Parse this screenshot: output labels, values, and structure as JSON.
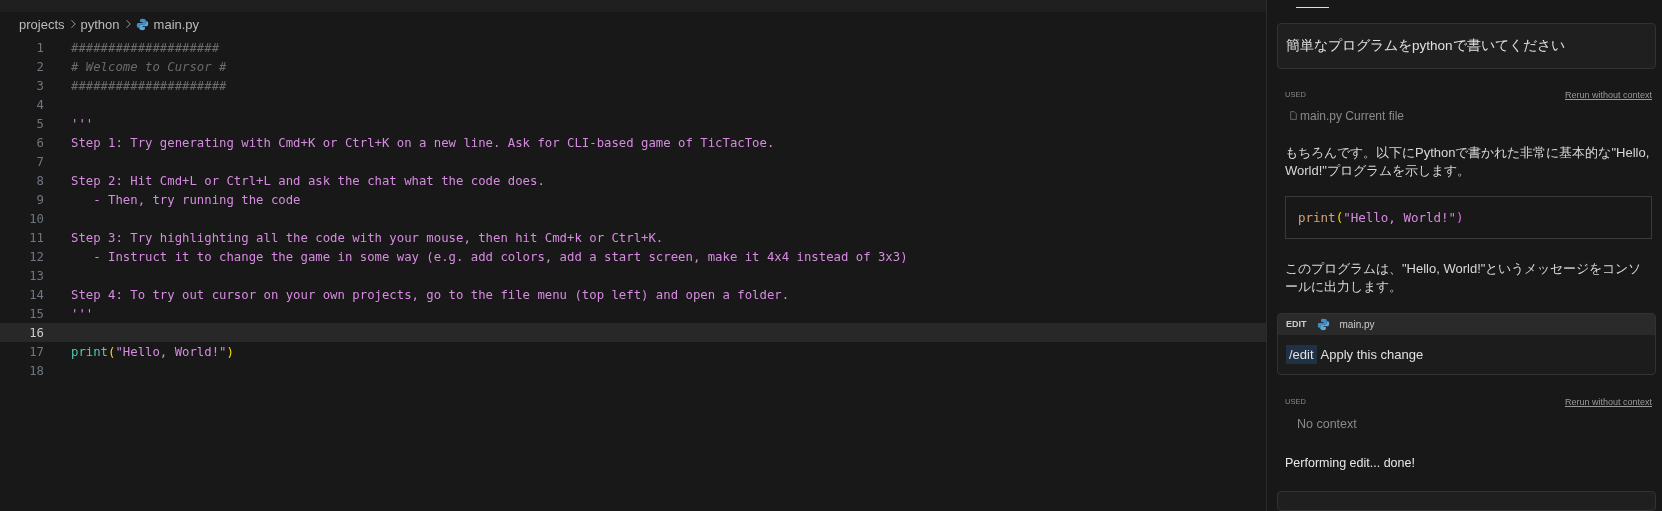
{
  "breadcrumb": [
    "projects",
    "python",
    "main.py"
  ],
  "editor": {
    "lines": [
      {
        "number": "1",
        "current": false,
        "tokens": [
          {
            "text": "####################",
            "kind": "comment"
          }
        ]
      },
      {
        "number": "2",
        "current": false,
        "tokens": [
          {
            "text": "# Welcome to Cursor #",
            "kind": "comment"
          }
        ]
      },
      {
        "number": "3",
        "current": false,
        "tokens": [
          {
            "text": "#####################",
            "kind": "comment"
          }
        ]
      },
      {
        "number": "4",
        "current": false
      },
      {
        "number": "5",
        "current": false,
        "tokens": [
          {
            "text": "'''",
            "kind": "string"
          }
        ]
      },
      {
        "number": "6",
        "current": false,
        "tokens": [
          {
            "text": "Step 1: Try generating with Cmd+K or Ctrl+K on a new line. Ask for CLI-based game of TicTacToe.",
            "kind": "string"
          }
        ]
      },
      {
        "number": "7",
        "current": false
      },
      {
        "number": "8",
        "current": false,
        "tokens": [
          {
            "text": "Step 2: Hit Cmd+L or Ctrl+L and ask the chat what the code does.",
            "kind": "string"
          }
        ]
      },
      {
        "number": "9",
        "current": false,
        "tokens": [
          {
            "text": "   - Then, try running the code",
            "kind": "string"
          }
        ]
      },
      {
        "number": "10",
        "current": false
      },
      {
        "number": "11",
        "current": false,
        "tokens": [
          {
            "text": "Step 3: Try highlighting all the code with your mouse, then hit Cmd+k or Ctrl+K.",
            "kind": "string"
          }
        ]
      },
      {
        "number": "12",
        "current": false,
        "tokens": [
          {
            "text": "   - Instruct it to change the game in some way (e.g. add colors, add a start screen, make it 4x4 instead of 3x3)",
            "kind": "string"
          }
        ]
      },
      {
        "number": "13",
        "current": false
      },
      {
        "number": "14",
        "current": false,
        "tokens": [
          {
            "text": "Step 4: To try out cursor on your own projects, go to the file menu (top left) and open a folder.",
            "kind": "string"
          }
        ]
      },
      {
        "number": "15",
        "current": false,
        "tokens": [
          {
            "text": "'''",
            "kind": "string"
          }
        ]
      },
      {
        "number": "16",
        "current": true
      },
      {
        "number": "17",
        "current": false,
        "tokens": [
          {
            "text": "print",
            "kind": "function"
          },
          {
            "text": "(",
            "kind": "bracket"
          },
          {
            "text": "\"Hello, World!\"",
            "kind": "string"
          },
          {
            "text": ")",
            "kind": "bracket"
          }
        ]
      },
      {
        "number": "18",
        "current": false
      }
    ]
  },
  "chat": {
    "query": "簡単なプログラムをpythonで書いてください",
    "used_1": {
      "label": "USED",
      "rerun": "Rerun without context",
      "file": "main.py",
      "file_note": "Current file"
    },
    "answer": "もちろんです。以下にPythonで書かれた非常に基本的な\"Hello, World!\"プログラムを示します。",
    "code_tokens": [
      {
        "text": "print",
        "kind": "builtin"
      },
      {
        "text": "(",
        "kind": "bracket"
      },
      {
        "text": "\"Hello, World!\"",
        "kind": "string"
      },
      {
        "text": ")",
        "kind": "bracket2"
      }
    ],
    "explanation": "このプログラムは、\"Hello, World!\"というメッセージをコンソールに出力します。",
    "edit_card": {
      "label": "EDIT",
      "file": "main.py",
      "command": "/edit",
      "action": "Apply this change"
    },
    "used_2": {
      "label": "USED",
      "rerun": "Rerun without context",
      "context": "No context"
    },
    "status": "Performing edit... done!"
  }
}
